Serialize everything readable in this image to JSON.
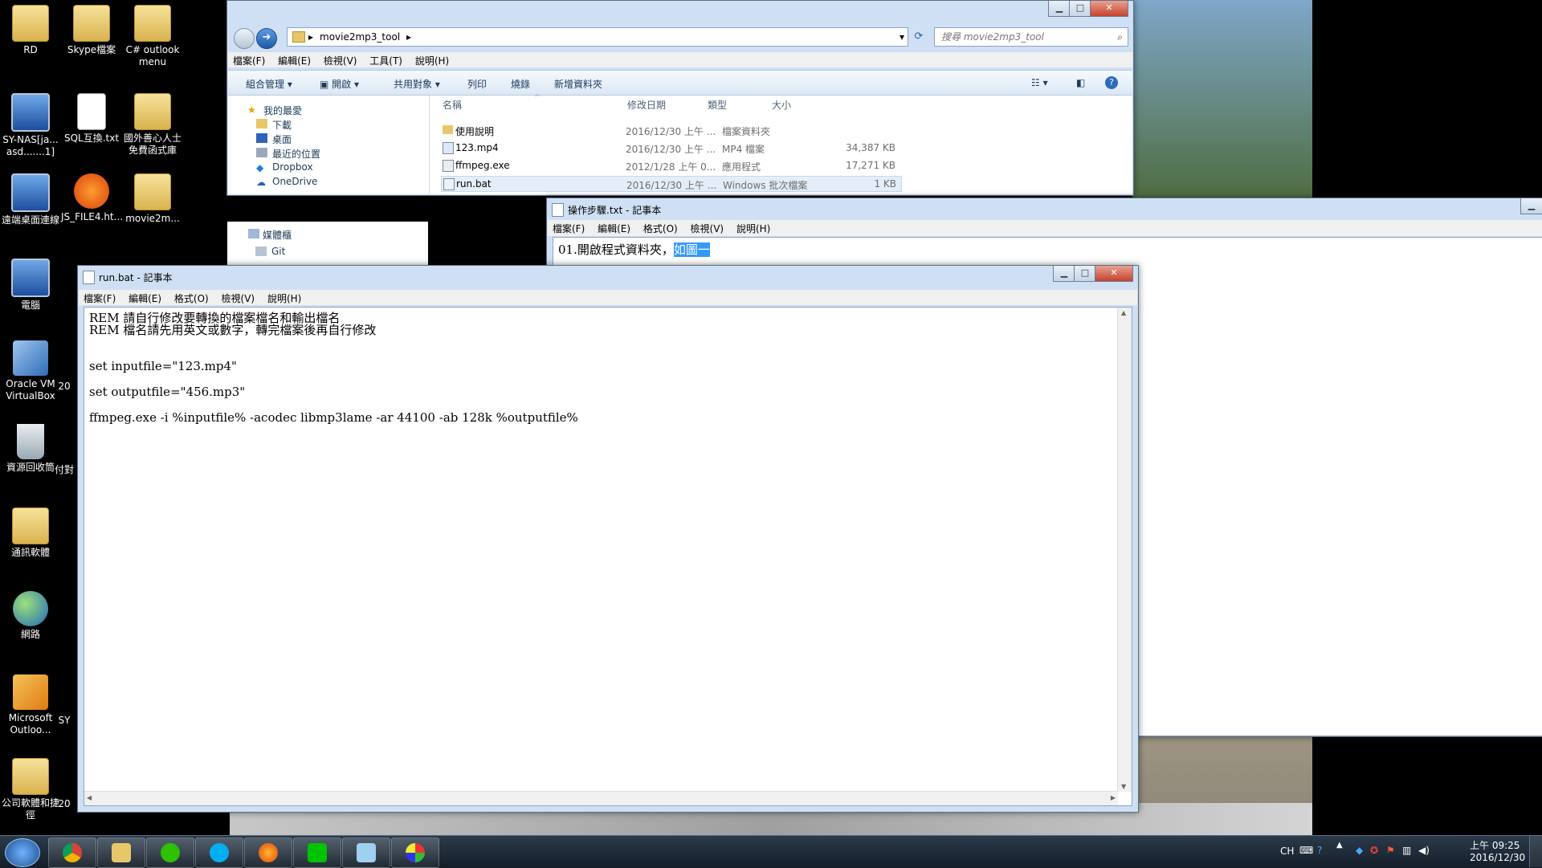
{
  "desktop": {
    "icons": [
      {
        "label": "RD"
      },
      {
        "label": "Skype檔案"
      },
      {
        "label": "C# outlook menu"
      },
      {
        "label": "SY-NAS[ja... asd.......1]"
      },
      {
        "label": "SQL互換.txt"
      },
      {
        "label": "國外善心人士免費函式庫"
      },
      {
        "label": "遠端桌面連線"
      },
      {
        "label": "JS_FILE4.ht..."
      },
      {
        "label": "movie2m..."
      },
      {
        "label": "電腦"
      },
      {
        "label": "Oracle VM VirtualBox"
      },
      {
        "label": "20"
      },
      {
        "label": "資源回收筒"
      },
      {
        "label": "付對"
      },
      {
        "label": "通訊軟體"
      },
      {
        "label": "網路"
      },
      {
        "label": "Microsoft Outloo..."
      },
      {
        "label": "SY"
      },
      {
        "label": "公司軟體和捷徑"
      },
      {
        "label": "20"
      }
    ]
  },
  "explorer": {
    "breadcrumb": [
      "movie2mp3_tool"
    ],
    "search_placeholder": "搜尋 movie2mp3_tool",
    "menu": [
      "檔案(F)",
      "編輯(E)",
      "檢視(V)",
      "工具(T)",
      "說明(H)"
    ],
    "toolbar": [
      "組合管理",
      "開啟",
      "共用對象",
      "列印",
      "燒錄",
      "新增資料夾"
    ],
    "nav": [
      "我的最愛",
      "下載",
      "桌面",
      "最近的位置",
      "Dropbox",
      "OneDrive",
      "媒體櫃",
      "Git"
    ],
    "columns": [
      "名稱",
      "修改日期",
      "類型",
      "大小"
    ],
    "files": [
      {
        "name": "使用說明",
        "date": "2016/12/30 上午 ...",
        "type": "檔案資料夾",
        "size": ""
      },
      {
        "name": "123.mp4",
        "date": "2016/12/30 上午 ...",
        "type": "MP4 檔案",
        "size": "34,387 KB"
      },
      {
        "name": "ffmpeg.exe",
        "date": "2012/1/28 上午 0...",
        "type": "應用程式",
        "size": "17,271 KB"
      },
      {
        "name": "run.bat",
        "date": "2016/12/30 上午 ...",
        "type": "Windows 批次檔案",
        "size": "1 KB"
      }
    ]
  },
  "notepad_steps": {
    "title": "操作步驟.txt - 記事本",
    "menu": [
      "檔案(F)",
      "編輯(E)",
      "格式(O)",
      "檢視(V)",
      "說明(H)"
    ],
    "line1_prefix": "01.開啟程式資料夾，",
    "line1_selected": "如圖一"
  },
  "notepad_run": {
    "title": "run.bat - 記事本",
    "menu": [
      "檔案(F)",
      "編輯(E)",
      "格式(O)",
      "檢視(V)",
      "說明(H)"
    ],
    "lines": [
      "REM 請自行修改要轉換的檔案檔名和輸出檔名",
      "REM 檔名請先用英文或數字，轉完檔案後再自行修改",
      "set inputfile=\"123.mp4\"",
      "set outputfile=\"456.mp3\"",
      "ffmpeg.exe -i %inputfile% -acodec libmp3lame -ar 44100 -ab 128k %outputfile%"
    ]
  },
  "taskbar": {
    "apps": [
      "start",
      "chrome",
      "explorer",
      "wechat",
      "skype",
      "firefox",
      "line",
      "notepad",
      "paint"
    ],
    "lang": "CH",
    "time": "上午 09:25",
    "date": "2016/12/30"
  },
  "colors": {
    "selection": "#3399ff",
    "taskbar": "#1b2836",
    "window_frame": "#c5d7ee"
  }
}
